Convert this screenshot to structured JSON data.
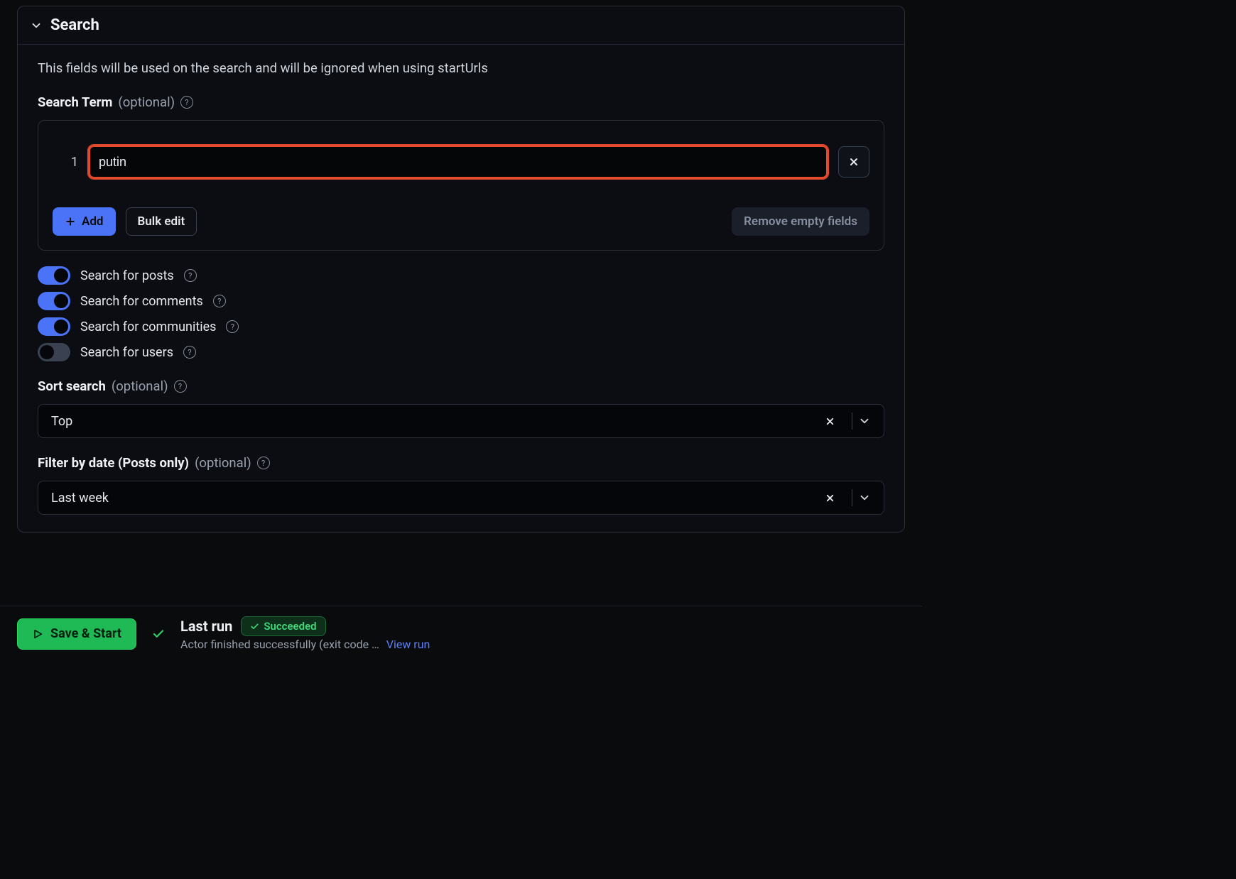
{
  "section": {
    "title": "Search",
    "description": "This fields will be used on the search and will be ignored when using startUrls"
  },
  "searchTerm": {
    "label": "Search Term",
    "optional": "(optional)",
    "lineNumber": "1",
    "value": "putin",
    "addLabel": "Add",
    "bulkEditLabel": "Bulk edit",
    "removeEmptyLabel": "Remove empty fields"
  },
  "toggles": {
    "posts": {
      "label": "Search for posts",
      "on": true
    },
    "comments": {
      "label": "Search for comments",
      "on": true
    },
    "communities": {
      "label": "Search for communities",
      "on": true
    },
    "users": {
      "label": "Search for users",
      "on": false
    }
  },
  "sort": {
    "label": "Sort search",
    "optional": "(optional)",
    "value": "Top"
  },
  "filterDate": {
    "label": "Filter by date (Posts only)",
    "optional": "(optional)",
    "value": "Last week"
  },
  "bottom": {
    "saveStart": "Save & Start",
    "lastRun": "Last run",
    "statusText": "Succeeded",
    "subText": "Actor finished successfully (exit code …",
    "viewRun": "View run"
  }
}
